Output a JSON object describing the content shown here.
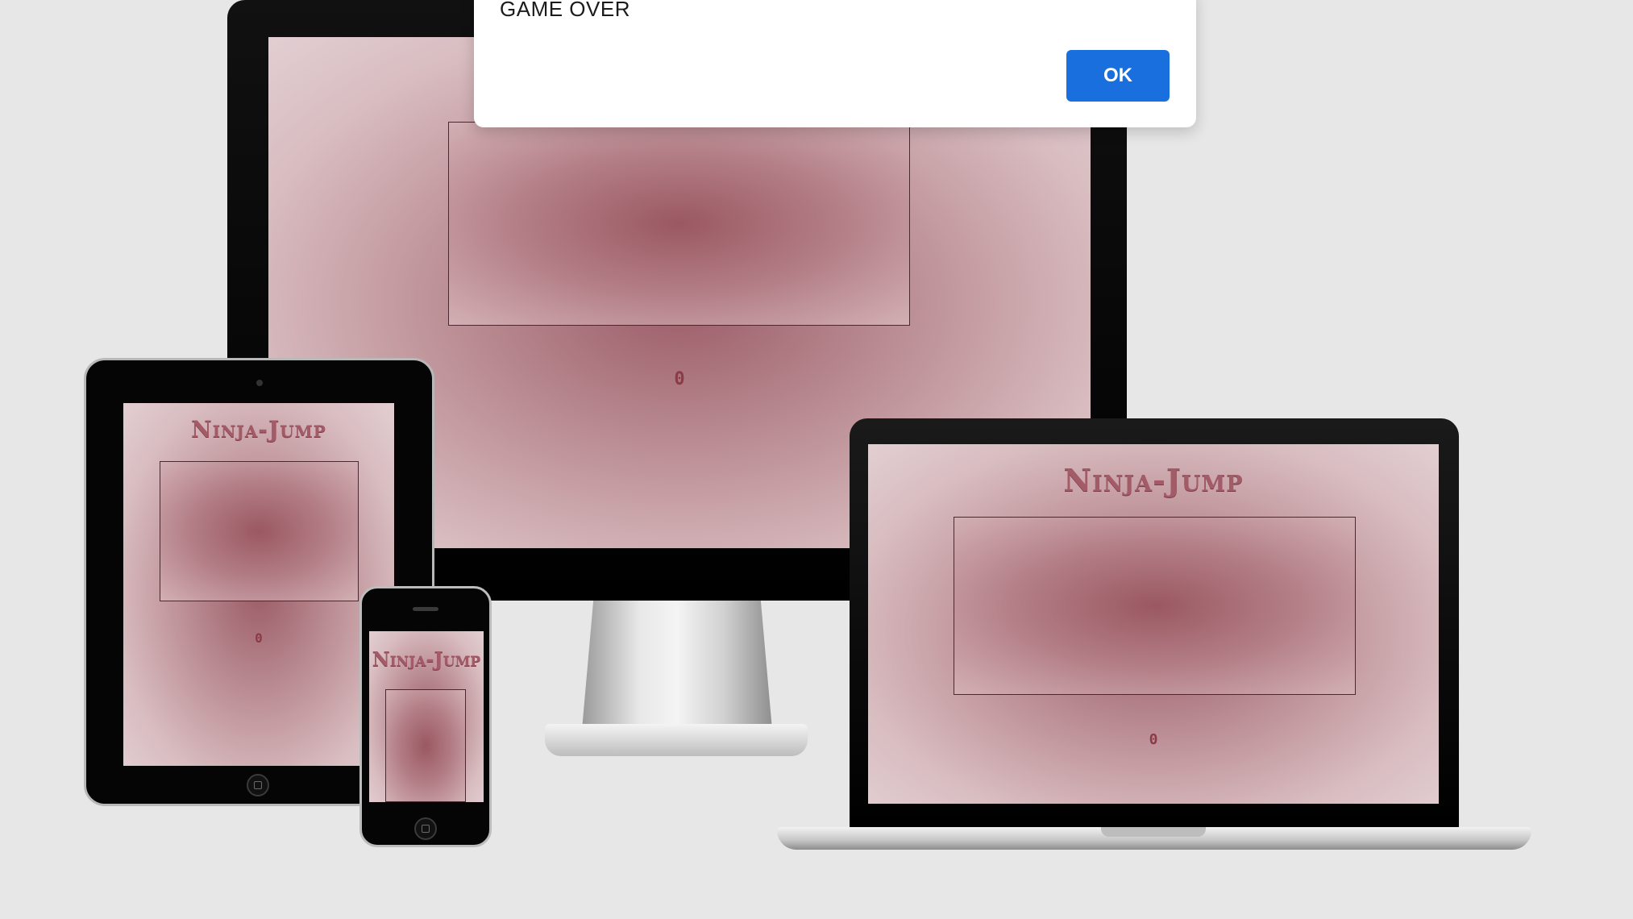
{
  "alert": {
    "message": "GAME OVER",
    "ok_label": "OK"
  },
  "game": {
    "title": "Ninja-Jump",
    "score": "0"
  },
  "colors": {
    "accent_button": "#1a6fdf",
    "title_color": "#a35b67",
    "page_background": "#e7e7e7"
  }
}
